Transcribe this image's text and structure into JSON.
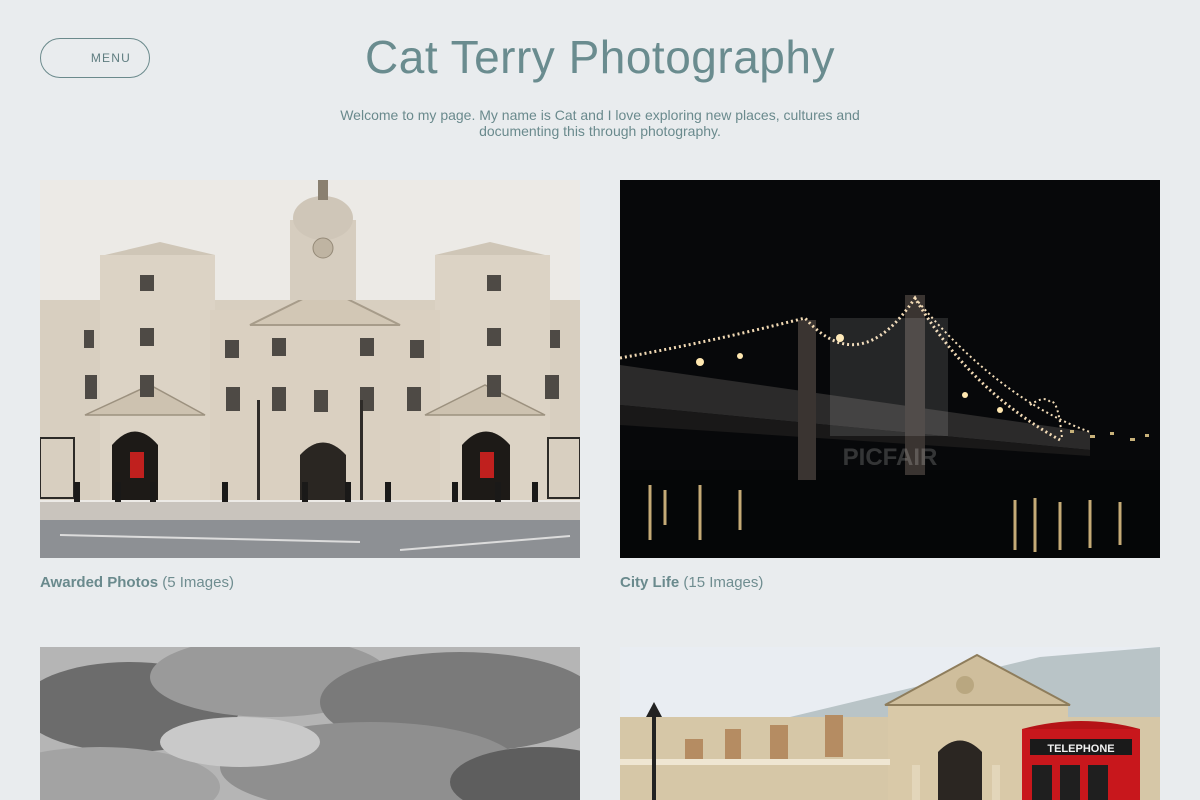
{
  "header": {
    "menu_label": "MENU",
    "site_title": "Cat Terry Photography",
    "intro": "Welcome to my page. My name is Cat and I love exploring new places, cultures and documenting this through photography."
  },
  "gallery": [
    {
      "title": "Awarded Photos",
      "count": "(5 Images)",
      "image": "palace-courtyard-photo"
    },
    {
      "title": "City Life",
      "count": "(15 Images)",
      "image": "bridge-at-night-photo"
    },
    {
      "title": "",
      "count": "",
      "image": "cloudy-sky-photo"
    },
    {
      "title": "",
      "count": "",
      "image": "market-hall-telephone-box-photo"
    }
  ],
  "watermark_text": "PICFAIR",
  "phone_box_text": "TELEPHONE"
}
